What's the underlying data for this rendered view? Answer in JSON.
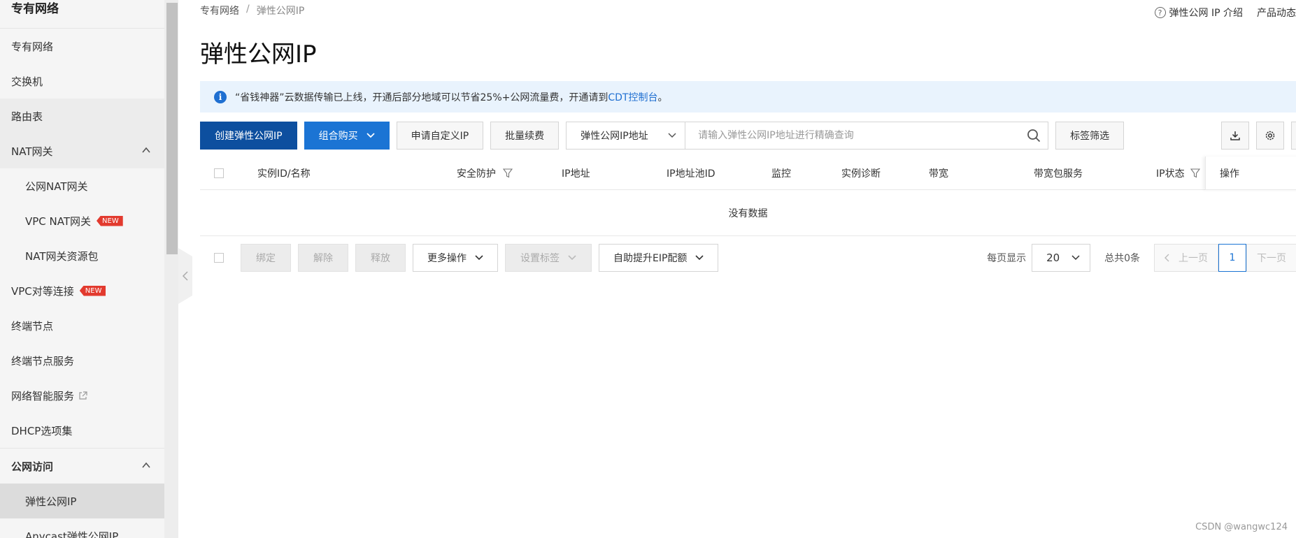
{
  "sidebar": {
    "title": "专有网络",
    "items": [
      {
        "label": "专有网络"
      },
      {
        "label": "交换机"
      },
      {
        "label": "路由表"
      },
      {
        "label": "NAT网关"
      },
      {
        "label": "公网NAT网关"
      },
      {
        "label": "VPC NAT网关",
        "badge": "NEW"
      },
      {
        "label": "NAT网关资源包"
      },
      {
        "label": "VPC对等连接",
        "badge": "NEW"
      },
      {
        "label": "终端节点"
      },
      {
        "label": "终端节点服务"
      },
      {
        "label": "网络智能服务"
      },
      {
        "label": "DHCP选项集"
      },
      {
        "label": "公网访问"
      },
      {
        "label": "弹性公网IP"
      },
      {
        "label": "Anycast弹性公网IP"
      }
    ]
  },
  "breadcrumb": {
    "root": "专有网络",
    "sep": "/",
    "current": "弹性公网IP"
  },
  "top_links": {
    "intro": "弹性公网 IP 介绍",
    "news": "产品动态"
  },
  "page_title": "弹性公网IP",
  "notice": {
    "text": "“省钱神器”云数据传输已上线，开通后部分地域可以节省25%+公网流量费，开通请到",
    "link": "CDT控制台",
    "suffix": "。"
  },
  "toolbar": {
    "create": "创建弹性公网IP",
    "combo": "组合购买",
    "apply_custom": "申请自定义IP",
    "batch_renew": "批量续费",
    "search_type": "弹性公网IP地址",
    "search_placeholder": "请输入弹性公网IP地址进行精确查询",
    "tag_filter": "标签筛选"
  },
  "table": {
    "columns": [
      "实例ID/名称",
      "安全防护",
      "IP地址",
      "IP地址池ID",
      "监控",
      "实例诊断",
      "带宽",
      "带宽包服务",
      "IP状态",
      "操作"
    ],
    "empty_text": "没有数据"
  },
  "bottom": {
    "bind": "绑定",
    "unbind": "解除",
    "release": "释放",
    "more": "更多操作",
    "set_tags": "设置标签",
    "quota": "自助提升EIP配额",
    "per_page_label": "每页显示",
    "per_page": "20",
    "total": "总共0条",
    "prev": "上一页",
    "current_page": "1",
    "next": "下一页"
  },
  "watermark": "CSDN @wangwc124",
  "colors": {
    "primary": "#1b74d4",
    "primary_dark": "#0d4f9f",
    "badge": "#e23a2e",
    "notice_bg": "#e9f3fd"
  }
}
